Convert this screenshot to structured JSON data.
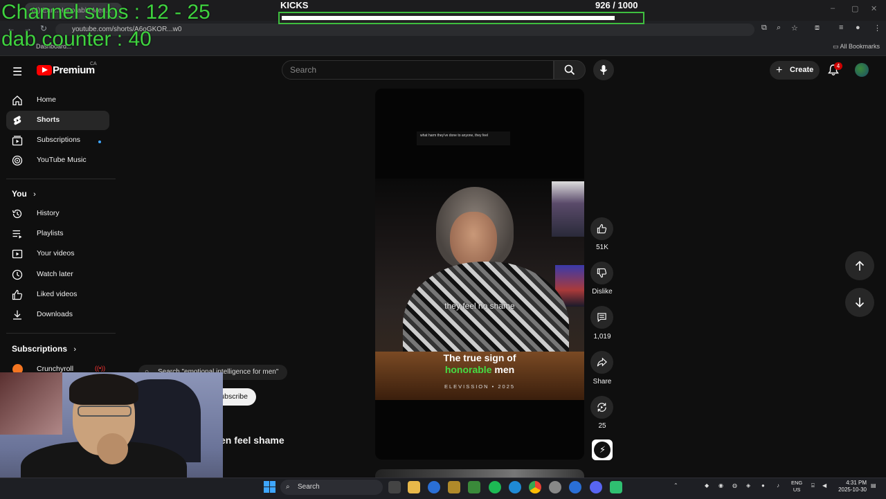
{
  "overlay": {
    "channel_subs": "Channel subs : 12 - 25",
    "dab_counter": "dab counter : 40",
    "kicks_label": "KICKS",
    "kicks_count": "926   / 1000",
    "kicks_progress": 0.926
  },
  "browser": {
    "tab_title": "(4) Ear...Honorable Men...",
    "url": "youtube.com/shorts/A6oGKOR...w0",
    "bookmark_folder": "All Bookmarks",
    "bookmark_item": "Dashboard..."
  },
  "header": {
    "brand": "Premium",
    "region": "CA",
    "search_placeholder": "Search",
    "create_label": "Create",
    "notification_count": "4"
  },
  "sidebar": {
    "items": [
      {
        "label": "Home",
        "icon": "home-icon"
      },
      {
        "label": "Shorts",
        "icon": "shorts-icon"
      },
      {
        "label": "Subscriptions",
        "icon": "subscriptions-icon"
      },
      {
        "label": "YouTube Music",
        "icon": "music-icon"
      }
    ],
    "you_section": "You",
    "you_items": [
      {
        "label": "History",
        "icon": "history-icon"
      },
      {
        "label": "Playlists",
        "icon": "playlists-icon"
      },
      {
        "label": "Your videos",
        "icon": "your-videos-icon"
      },
      {
        "label": "Watch later",
        "icon": "clock-icon"
      },
      {
        "label": "Liked videos",
        "icon": "thumbs-up-icon"
      },
      {
        "label": "Downloads",
        "icon": "download-icon"
      }
    ],
    "subscriptions_section": "Subscriptions",
    "subscription_items": [
      {
        "label": "Crunchyroll"
      }
    ]
  },
  "short": {
    "caption_top": "what harm they've done to anyone, they feel",
    "subtitle": "they feel no shame",
    "title_line1": "The true sign of",
    "title_highlight": "honorable",
    "title_rest": " men",
    "credit": "ELEVISSION",
    "credit_year": "2025"
  },
  "actions": {
    "likes": "51K",
    "dislike": "Dislike",
    "comments": "1,019",
    "share": "Share",
    "remix": "25"
  },
  "below": {
    "search_suggestion": "Search \"emotional intelligence for men\"",
    "subscribe": "Subscribe",
    "title_fragment": "en feel shame"
  },
  "taskbar": {
    "search": "Search",
    "lang1": "ENG",
    "lang2": "US",
    "time": "4:31 PM",
    "date": "2025-10-30"
  },
  "colors": {
    "overlay_green": "#3fd33f",
    "youtube_red": "#ff0000",
    "highlight_green": "#44dd44"
  }
}
